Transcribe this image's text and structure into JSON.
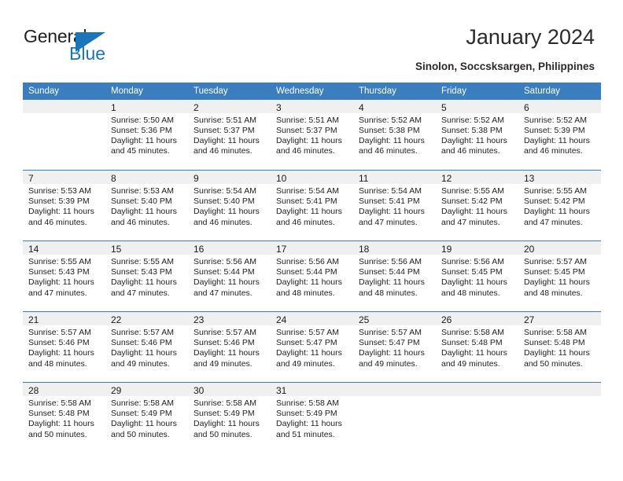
{
  "brand": {
    "name_part1": "General",
    "name_part2": "Blue",
    "accent_color": "#1b75bb"
  },
  "header": {
    "title": "January 2024",
    "subtitle": "Sinolon, Soccsksargen, Philippines"
  },
  "theme": {
    "header_row_bg": "#3a7ec0",
    "daynum_band_bg": "#f0f0f0",
    "text_color": "#222222"
  },
  "calendar": {
    "weekday_headers": [
      "Sunday",
      "Monday",
      "Tuesday",
      "Wednesday",
      "Thursday",
      "Friday",
      "Saturday"
    ],
    "leading_blanks": 1,
    "weeks": [
      [
        {
          "day": "",
          "sunrise": "",
          "sunset": "",
          "daylight_line1": "",
          "daylight_line2": ""
        },
        {
          "day": "1",
          "sunrise": "Sunrise: 5:50 AM",
          "sunset": "Sunset: 5:36 PM",
          "daylight_line1": "Daylight: 11 hours",
          "daylight_line2": "and 45 minutes."
        },
        {
          "day": "2",
          "sunrise": "Sunrise: 5:51 AM",
          "sunset": "Sunset: 5:37 PM",
          "daylight_line1": "Daylight: 11 hours",
          "daylight_line2": "and 46 minutes."
        },
        {
          "day": "3",
          "sunrise": "Sunrise: 5:51 AM",
          "sunset": "Sunset: 5:37 PM",
          "daylight_line1": "Daylight: 11 hours",
          "daylight_line2": "and 46 minutes."
        },
        {
          "day": "4",
          "sunrise": "Sunrise: 5:52 AM",
          "sunset": "Sunset: 5:38 PM",
          "daylight_line1": "Daylight: 11 hours",
          "daylight_line2": "and 46 minutes."
        },
        {
          "day": "5",
          "sunrise": "Sunrise: 5:52 AM",
          "sunset": "Sunset: 5:38 PM",
          "daylight_line1": "Daylight: 11 hours",
          "daylight_line2": "and 46 minutes."
        },
        {
          "day": "6",
          "sunrise": "Sunrise: 5:52 AM",
          "sunset": "Sunset: 5:39 PM",
          "daylight_line1": "Daylight: 11 hours",
          "daylight_line2": "and 46 minutes."
        }
      ],
      [
        {
          "day": "7",
          "sunrise": "Sunrise: 5:53 AM",
          "sunset": "Sunset: 5:39 PM",
          "daylight_line1": "Daylight: 11 hours",
          "daylight_line2": "and 46 minutes."
        },
        {
          "day": "8",
          "sunrise": "Sunrise: 5:53 AM",
          "sunset": "Sunset: 5:40 PM",
          "daylight_line1": "Daylight: 11 hours",
          "daylight_line2": "and 46 minutes."
        },
        {
          "day": "9",
          "sunrise": "Sunrise: 5:54 AM",
          "sunset": "Sunset: 5:40 PM",
          "daylight_line1": "Daylight: 11 hours",
          "daylight_line2": "and 46 minutes."
        },
        {
          "day": "10",
          "sunrise": "Sunrise: 5:54 AM",
          "sunset": "Sunset: 5:41 PM",
          "daylight_line1": "Daylight: 11 hours",
          "daylight_line2": "and 46 minutes."
        },
        {
          "day": "11",
          "sunrise": "Sunrise: 5:54 AM",
          "sunset": "Sunset: 5:41 PM",
          "daylight_line1": "Daylight: 11 hours",
          "daylight_line2": "and 47 minutes."
        },
        {
          "day": "12",
          "sunrise": "Sunrise: 5:55 AM",
          "sunset": "Sunset: 5:42 PM",
          "daylight_line1": "Daylight: 11 hours",
          "daylight_line2": "and 47 minutes."
        },
        {
          "day": "13",
          "sunrise": "Sunrise: 5:55 AM",
          "sunset": "Sunset: 5:42 PM",
          "daylight_line1": "Daylight: 11 hours",
          "daylight_line2": "and 47 minutes."
        }
      ],
      [
        {
          "day": "14",
          "sunrise": "Sunrise: 5:55 AM",
          "sunset": "Sunset: 5:43 PM",
          "daylight_line1": "Daylight: 11 hours",
          "daylight_line2": "and 47 minutes."
        },
        {
          "day": "15",
          "sunrise": "Sunrise: 5:55 AM",
          "sunset": "Sunset: 5:43 PM",
          "daylight_line1": "Daylight: 11 hours",
          "daylight_line2": "and 47 minutes."
        },
        {
          "day": "16",
          "sunrise": "Sunrise: 5:56 AM",
          "sunset": "Sunset: 5:44 PM",
          "daylight_line1": "Daylight: 11 hours",
          "daylight_line2": "and 47 minutes."
        },
        {
          "day": "17",
          "sunrise": "Sunrise: 5:56 AM",
          "sunset": "Sunset: 5:44 PM",
          "daylight_line1": "Daylight: 11 hours",
          "daylight_line2": "and 48 minutes."
        },
        {
          "day": "18",
          "sunrise": "Sunrise: 5:56 AM",
          "sunset": "Sunset: 5:44 PM",
          "daylight_line1": "Daylight: 11 hours",
          "daylight_line2": "and 48 minutes."
        },
        {
          "day": "19",
          "sunrise": "Sunrise: 5:56 AM",
          "sunset": "Sunset: 5:45 PM",
          "daylight_line1": "Daylight: 11 hours",
          "daylight_line2": "and 48 minutes."
        },
        {
          "day": "20",
          "sunrise": "Sunrise: 5:57 AM",
          "sunset": "Sunset: 5:45 PM",
          "daylight_line1": "Daylight: 11 hours",
          "daylight_line2": "and 48 minutes."
        }
      ],
      [
        {
          "day": "21",
          "sunrise": "Sunrise: 5:57 AM",
          "sunset": "Sunset: 5:46 PM",
          "daylight_line1": "Daylight: 11 hours",
          "daylight_line2": "and 48 minutes."
        },
        {
          "day": "22",
          "sunrise": "Sunrise: 5:57 AM",
          "sunset": "Sunset: 5:46 PM",
          "daylight_line1": "Daylight: 11 hours",
          "daylight_line2": "and 49 minutes."
        },
        {
          "day": "23",
          "sunrise": "Sunrise: 5:57 AM",
          "sunset": "Sunset: 5:46 PM",
          "daylight_line1": "Daylight: 11 hours",
          "daylight_line2": "and 49 minutes."
        },
        {
          "day": "24",
          "sunrise": "Sunrise: 5:57 AM",
          "sunset": "Sunset: 5:47 PM",
          "daylight_line1": "Daylight: 11 hours",
          "daylight_line2": "and 49 minutes."
        },
        {
          "day": "25",
          "sunrise": "Sunrise: 5:57 AM",
          "sunset": "Sunset: 5:47 PM",
          "daylight_line1": "Daylight: 11 hours",
          "daylight_line2": "and 49 minutes."
        },
        {
          "day": "26",
          "sunrise": "Sunrise: 5:58 AM",
          "sunset": "Sunset: 5:48 PM",
          "daylight_line1": "Daylight: 11 hours",
          "daylight_line2": "and 49 minutes."
        },
        {
          "day": "27",
          "sunrise": "Sunrise: 5:58 AM",
          "sunset": "Sunset: 5:48 PM",
          "daylight_line1": "Daylight: 11 hours",
          "daylight_line2": "and 50 minutes."
        }
      ],
      [
        {
          "day": "28",
          "sunrise": "Sunrise: 5:58 AM",
          "sunset": "Sunset: 5:48 PM",
          "daylight_line1": "Daylight: 11 hours",
          "daylight_line2": "and 50 minutes."
        },
        {
          "day": "29",
          "sunrise": "Sunrise: 5:58 AM",
          "sunset": "Sunset: 5:49 PM",
          "daylight_line1": "Daylight: 11 hours",
          "daylight_line2": "and 50 minutes."
        },
        {
          "day": "30",
          "sunrise": "Sunrise: 5:58 AM",
          "sunset": "Sunset: 5:49 PM",
          "daylight_line1": "Daylight: 11 hours",
          "daylight_line2": "and 50 minutes."
        },
        {
          "day": "31",
          "sunrise": "Sunrise: 5:58 AM",
          "sunset": "Sunset: 5:49 PM",
          "daylight_line1": "Daylight: 11 hours",
          "daylight_line2": "and 51 minutes."
        },
        {
          "day": "",
          "sunrise": "",
          "sunset": "",
          "daylight_line1": "",
          "daylight_line2": ""
        },
        {
          "day": "",
          "sunrise": "",
          "sunset": "",
          "daylight_line1": "",
          "daylight_line2": ""
        },
        {
          "day": "",
          "sunrise": "",
          "sunset": "",
          "daylight_line1": "",
          "daylight_line2": ""
        }
      ]
    ]
  }
}
